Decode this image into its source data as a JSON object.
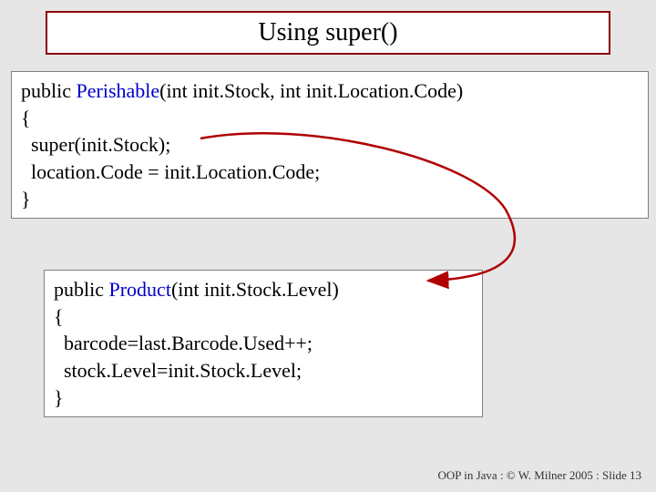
{
  "title": "Using super()",
  "code1": {
    "l1a": "public ",
    "l1b": "Perishable",
    "l1c": "(int init.Stock, int init.Location.Code)",
    "l2": "{",
    "l3": "  super(init.Stock);",
    "l4": "  location.Code = init.Location.Code;",
    "l5": "}"
  },
  "code2": {
    "l1a": "public ",
    "l1b": "Product",
    "l1c": "(int init.Stock.Level)",
    "l2": "{",
    "l3": "  barcode=last.Barcode.Used++;",
    "l4": "  stock.Level=init.Stock.Level;",
    "l5": "}"
  },
  "footer": "OOP in Java : © W. Milner 2005 : Slide 13"
}
